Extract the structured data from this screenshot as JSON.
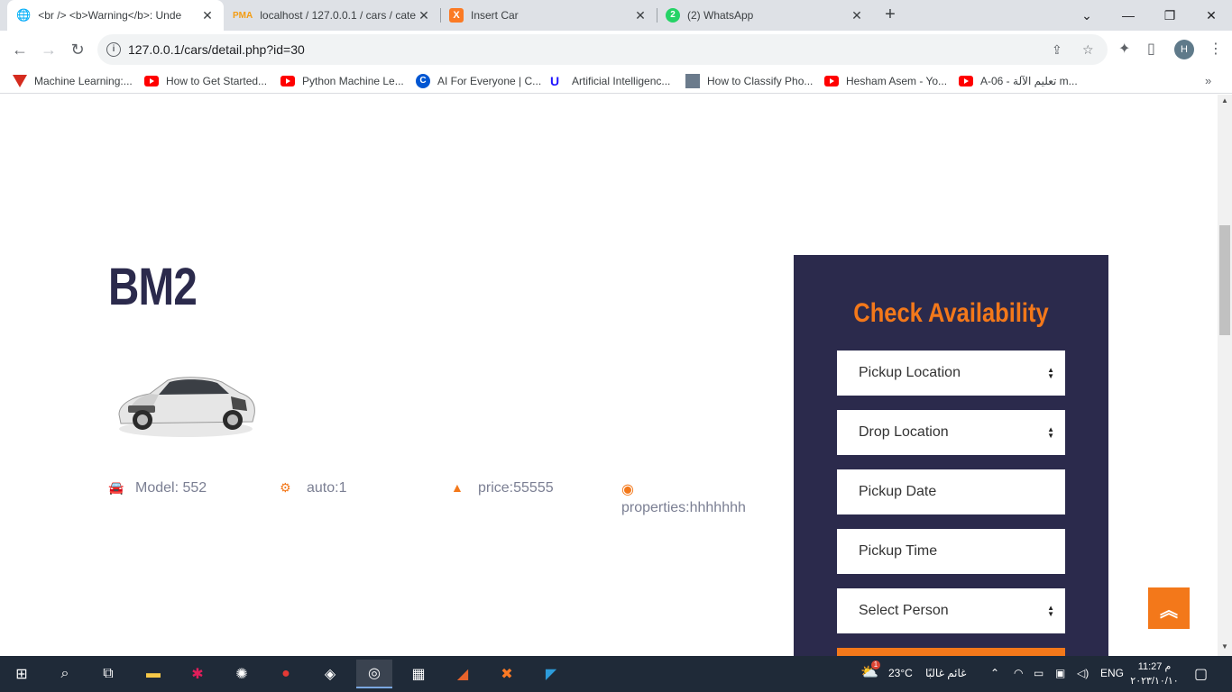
{
  "browser": {
    "tabs": [
      {
        "title": "<br /> <b>Warning</b>: Unde",
        "icon": "globe-icon",
        "active": true
      },
      {
        "title": "localhost / 127.0.0.1 / cars / cate",
        "icon": "phpmyadmin-icon",
        "active": false
      },
      {
        "title": "Insert Car",
        "icon": "xampp-icon",
        "active": false
      },
      {
        "title": "(2) WhatsApp",
        "icon": "whatsapp-icon",
        "active": false,
        "badge": "2"
      }
    ],
    "url": "127.0.0.1/cars/detail.php?id=30",
    "profile_initial": "H",
    "bookmarks": [
      {
        "label": "Machine Learning:...",
        "icon": "coursera-icon"
      },
      {
        "label": "How to Get Started...",
        "icon": "youtube-icon"
      },
      {
        "label": "Python Machine Le...",
        "icon": "youtube-icon"
      },
      {
        "label": "AI For Everyone | C...",
        "icon": "coursera-c-icon"
      },
      {
        "label": "Artificial Intelligenc...",
        "icon": "udacity-icon"
      },
      {
        "label": "How to Classify Pho...",
        "icon": "image-icon"
      },
      {
        "label": "Hesham Asem - Yo...",
        "icon": "youtube-icon"
      },
      {
        "label": "A-06 - تعليم الآلة m...",
        "icon": "youtube-icon"
      }
    ]
  },
  "page": {
    "car_name": "BM2",
    "specs": {
      "model": "Model: 552",
      "transmission": "auto:1",
      "price": "price:55555",
      "properties": "properties:hhhhhhh"
    },
    "availability": {
      "title": "Check Availability",
      "pickup_location": "Pickup Location",
      "drop_location": "Drop Location",
      "pickup_date": "Pickup Date",
      "pickup_time": "Pickup Time",
      "select_person": "Select Person"
    },
    "accent_color": "#f3781a",
    "panel_color": "#2b2a4c"
  },
  "taskbar": {
    "weather_temp": "23°C",
    "weather_text": "غائم غالبًا",
    "weather_badge": "1",
    "language": "ENG",
    "time": "11:27 م",
    "date": "٢٠٢٣/١٠/١٠"
  }
}
